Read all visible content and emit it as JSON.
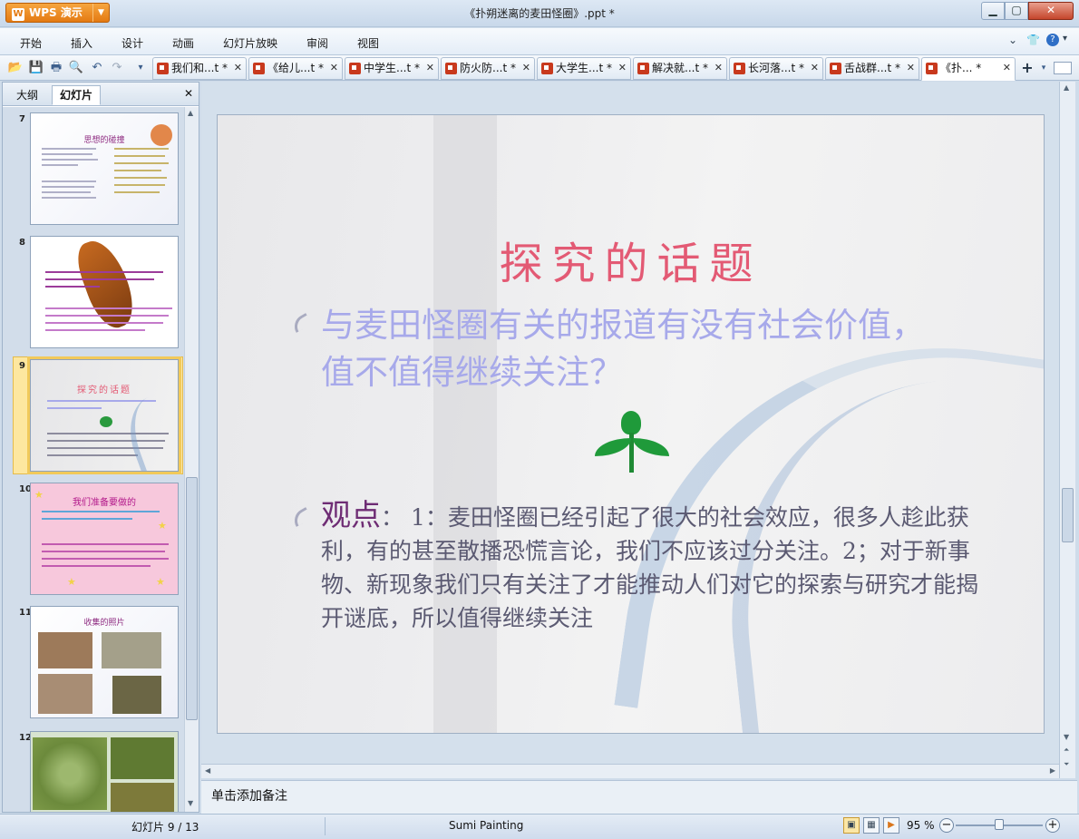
{
  "app": {
    "logo_label": "WPS 演示",
    "document_title": "《扑朔迷离的麦田怪圈》.ppt *"
  },
  "window_buttons": {
    "minimize": "▁",
    "maximize": "▢",
    "close": "✕"
  },
  "menu": {
    "items": [
      "开始",
      "插入",
      "设计",
      "动画",
      "幻灯片放映",
      "审阅",
      "视图"
    ]
  },
  "tabs": [
    {
      "label": "我们和...t *",
      "close": "✕"
    },
    {
      "label": "《给儿...t *",
      "close": "✕"
    },
    {
      "label": "中学生...t *",
      "close": "✕"
    },
    {
      "label": "防火防...t *",
      "close": "✕"
    },
    {
      "label": "大学生...t *",
      "close": "✕"
    },
    {
      "label": "解决就...t *",
      "close": "✕"
    },
    {
      "label": "长河落...t *",
      "close": "✕"
    },
    {
      "label": "舌战群...t *",
      "close": "✕"
    },
    {
      "label": "《扑... *",
      "close": "✕"
    }
  ],
  "new_tab_label": "+",
  "left_panel": {
    "tab_outline": "大纲",
    "tab_slides": "幻灯片",
    "close": "✕"
  },
  "thumbnails": [
    {
      "number": "7",
      "title": "思想的碰撞"
    },
    {
      "number": "8",
      "title": ""
    },
    {
      "number": "9",
      "title": "探究的话题"
    },
    {
      "number": "10",
      "title": "我们准备要做的"
    },
    {
      "number": "11",
      "title": "收集的照片"
    },
    {
      "number": "12",
      "title": ""
    }
  ],
  "slide": {
    "title": "探究的话题",
    "bullet1": "与麦田怪圈有关的报道有没有社会价值，值不值得继续关注？",
    "bullet2_keyword": "观点",
    "bullet2_text": "： 1：麦田怪圈已经引起了很大的社会效应，很多人趁此获利，有的甚至散播恐慌言论，我们不应该过分关注。2；对于新事物、新现象我们只有关注了才能推动人们对它的探索与研究才能揭开谜底，所以值得继续关注"
  },
  "notes_placeholder": "单击添加备注",
  "status": {
    "slide_counter": "幻灯片 9 / 13",
    "theme": "Sumi Painting",
    "zoom": "95 %",
    "zoom_level_fraction": 0.5
  }
}
